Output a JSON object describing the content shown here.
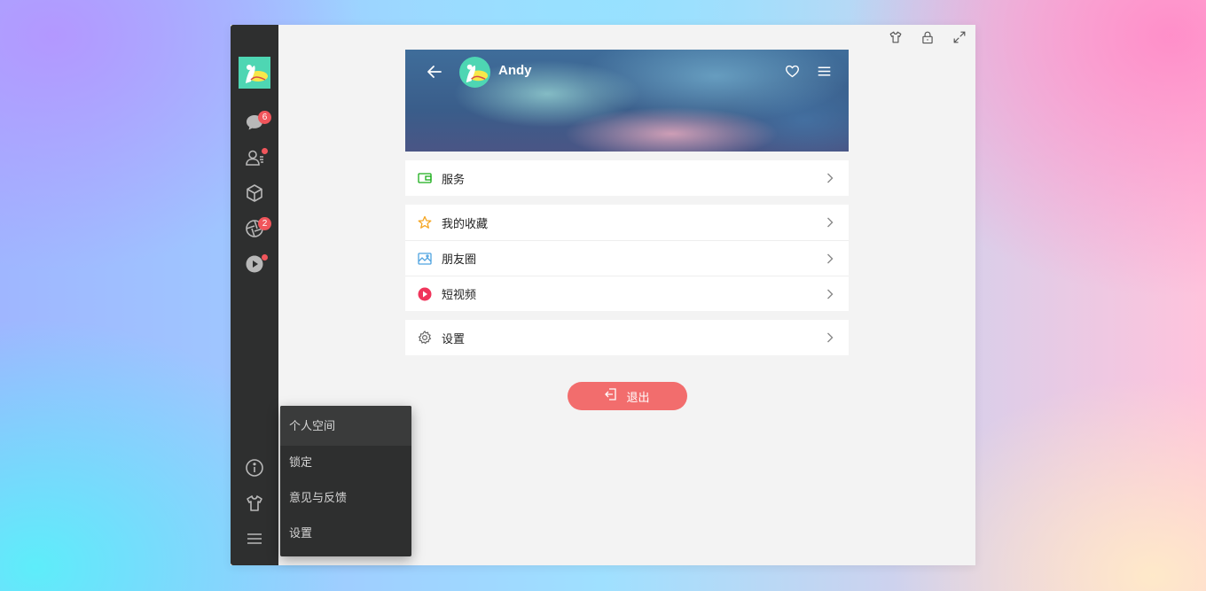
{
  "window": {
    "top_tools": [
      {
        "icon": "shirt-icon",
        "label": "skin"
      },
      {
        "icon": "lock-icon",
        "label": "lock"
      },
      {
        "icon": "expand-icon",
        "label": "fullscreen"
      }
    ]
  },
  "sidebar": {
    "logo_icon": "avatar-logo",
    "items": [
      {
        "icon": "chat-icon",
        "badge": "6"
      },
      {
        "icon": "contacts-icon",
        "dot": true
      },
      {
        "icon": "box-icon"
      },
      {
        "icon": "aperture-icon",
        "badge": "2"
      },
      {
        "icon": "play-circle-icon",
        "dot": true
      }
    ],
    "bottom_items": [
      {
        "icon": "info-icon"
      },
      {
        "icon": "shirt-icon"
      },
      {
        "icon": "menu-icon"
      }
    ]
  },
  "profile": {
    "name": "Andy",
    "groups": [
      [
        {
          "icon": "wallet-icon",
          "label": "服务",
          "color": "#1aad19"
        }
      ],
      [
        {
          "icon": "star-icon",
          "label": "我的收藏",
          "color": "#f5a623"
        },
        {
          "icon": "image-icon",
          "label": "朋友圈",
          "color": "#4fa3e0"
        },
        {
          "icon": "video-play-icon",
          "label": "短视频",
          "color": "#f0355b"
        }
      ],
      [
        {
          "icon": "gear-icon",
          "label": "设置",
          "color": "#666666"
        }
      ]
    ],
    "logout_label": "退出"
  },
  "popup_menu": {
    "items": [
      "个人空间",
      "锁定",
      "意见与反馈",
      "设置"
    ]
  }
}
